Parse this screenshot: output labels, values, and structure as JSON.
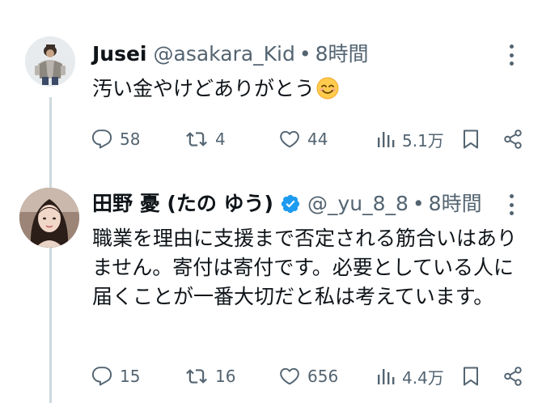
{
  "tweets": [
    {
      "name": "Jusei",
      "handle": "@asakara_Kid",
      "separator": "•",
      "time": "8時間",
      "text": "汚い金やけどありがとう",
      "emoji": "smiling-face-emoji",
      "replies": "58",
      "retweets": "4",
      "likes": "44",
      "views": "5.1万"
    },
    {
      "name": "田野 憂 (たの ゆう)",
      "verified": true,
      "handle": "@_yu_8_8",
      "separator": "•",
      "time": "8時間",
      "text": "職業を理由に支援まで否定される筋合いはありません。寄付は寄付です。必要としている人に届くことが一番大切だと私は考えています。",
      "replies": "15",
      "retweets": "16",
      "likes": "656",
      "views": "4.4万"
    }
  ],
  "icons": {
    "reply": "reply-icon",
    "retweet": "retweet-icon",
    "like": "heart-icon",
    "views": "views-icon",
    "bookmark": "bookmark-icon",
    "share": "share-icon",
    "more": "more-icon",
    "verified": "verified-badge-icon"
  },
  "colors": {
    "text": "#0f1419",
    "secondary": "#536471",
    "verified": "#1d9bf0",
    "thread_line": "#cfd9de"
  }
}
